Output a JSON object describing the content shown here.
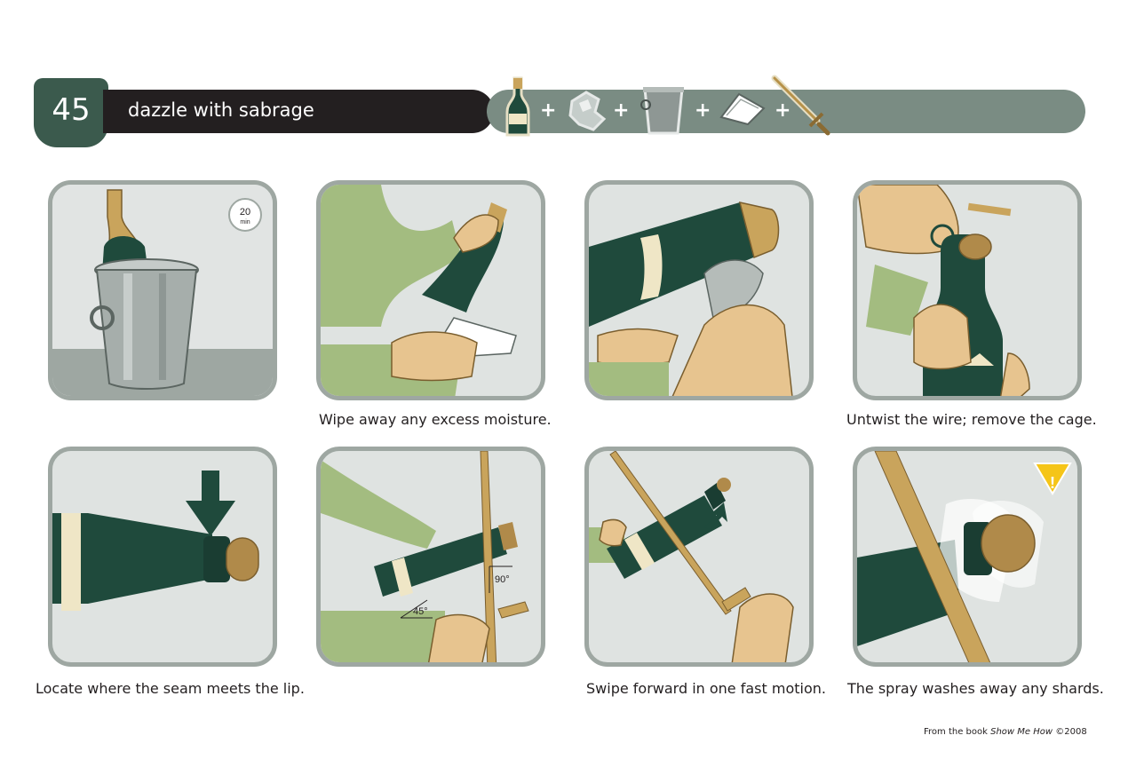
{
  "header": {
    "number": "45",
    "title": "dazzle with sabrage",
    "supplies": [
      "bottle-icon",
      "ice-icon",
      "bucket-icon",
      "napkin-icon",
      "sabre-icon"
    ],
    "plus": "+"
  },
  "steps": [
    {
      "caption": "",
      "timer": {
        "value": "20",
        "unit": "min"
      }
    },
    {
      "caption": "Wipe away any excess moisture."
    },
    {
      "caption": ""
    },
    {
      "caption": "Untwist the wire; remove the cage."
    },
    {
      "caption": "Locate where the seam meets the lip."
    },
    {
      "caption": "",
      "angles": [
        "90°",
        "45°"
      ]
    },
    {
      "caption": "Swipe forward in one fast motion."
    },
    {
      "caption": "The spray washes away any shards.",
      "warning": "!"
    }
  ],
  "footer": {
    "prefix": "From the book ",
    "book": "Show Me How",
    "suffix": " ©2008"
  }
}
